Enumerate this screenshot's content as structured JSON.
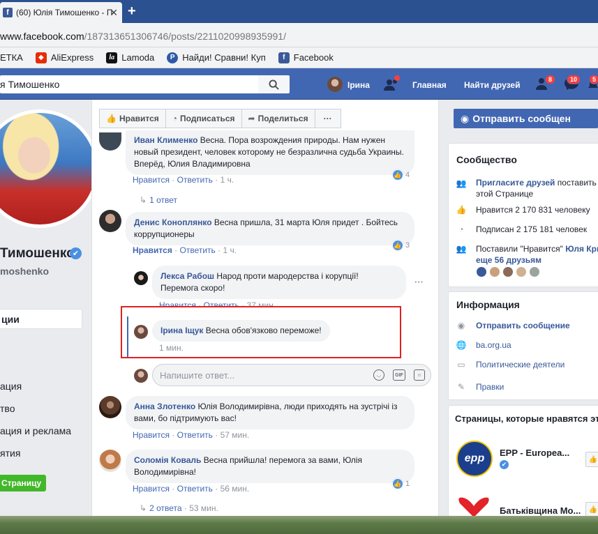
{
  "browser": {
    "tab_title": "(60) Юлія Тимошенко - П",
    "url_host": "www.facebook.com",
    "url_path": "/187313651306746/posts/2211020998935991/",
    "bookmarks": [
      "ЕТКА",
      "AliExpress",
      "Lamoda",
      "Найди! Сравни! Куп",
      "Facebook"
    ]
  },
  "fb_header": {
    "search_value": "я Тимошенко",
    "user_name": "Ірина",
    "nav": [
      "Главная",
      "Найти друзей"
    ],
    "badges": [
      "8",
      "10",
      "5"
    ]
  },
  "left": {
    "page_name": "Тимошенко",
    "page_handle": "moshenko",
    "active_menu": "ции",
    "menu": [
      "ация",
      "тво",
      "ация и реклама",
      "ятия"
    ],
    "create_page": "Страницу"
  },
  "actions": {
    "like": "Нравится",
    "subscribe": "Подписаться",
    "share": "Поделиться",
    "more": "···"
  },
  "comments": [
    {
      "name": "Иван Клименко",
      "text": "Весна. Пора возрождения природы. Нам нужен новый президент, человек которому не безразлична судьба Украины. Вперёд, Юлия Владимировна",
      "like": "Нравится",
      "reply": "Ответить",
      "time": "1 ч.",
      "reactions": "4",
      "replies": "1 ответ"
    },
    {
      "name": "Денис Коноплянко",
      "text": "Весна пришла, 31 марта Юля придет . Бойтесь коррупционеры",
      "like": "Нравится",
      "reply": "Ответить",
      "time": "1 ч.",
      "reactions": "3"
    },
    {
      "name": "Лекса Рабош",
      "text": "Народ проти мародерства і корупції! Перемога скоро!",
      "like": "Нравится",
      "reply": "Ответить",
      "time": "37 мин."
    },
    {
      "name": "Ірина Іщук",
      "text": "Весна обов'язково переможе!",
      "time": "1 мин."
    },
    {
      "name": "Анна Злотенко",
      "text": "Юлія Володимирівна, люди приходять на зустрічі із вами, бо підтримують вас!",
      "like": "Нравится",
      "reply": "Ответить",
      "time": "57 мин."
    },
    {
      "name": "Соломія Коваль",
      "text": "Весна прийшла! перемога за вами, Юлія Володимирівна!",
      "like": "Нравится",
      "reply": "Ответить",
      "time": "56 мин.",
      "reactions": "1",
      "replies": "2 ответа",
      "replies_time": "53 мин."
    }
  ],
  "reply_placeholder": "Напишите ответ...",
  "right": {
    "send_message": "Отправить сообщен",
    "community_title": "Сообщество",
    "invite_link": "Пригласите друзей",
    "invite_rest": " поставить",
    "invite_line2": "этой Странице",
    "likes": "Нравится 2 170 831 человеку",
    "followers": "Подписан 2 175 181 человек",
    "liked_by_prefix": "Поставили \"Нравится\" ",
    "liked_by_name": "Юля Кри",
    "liked_by_more": "еще 56 друзьям",
    "info_title": "Информация",
    "info_send": "Отправить сообщение",
    "info_site": "ba.org.ua",
    "info_category": "Политические деятели",
    "info_edit": "Правки",
    "pages_title": "Страницы, которые нравятся этой",
    "pages": [
      "EPP - Europea...",
      "Батьківщина Мо..."
    ]
  }
}
